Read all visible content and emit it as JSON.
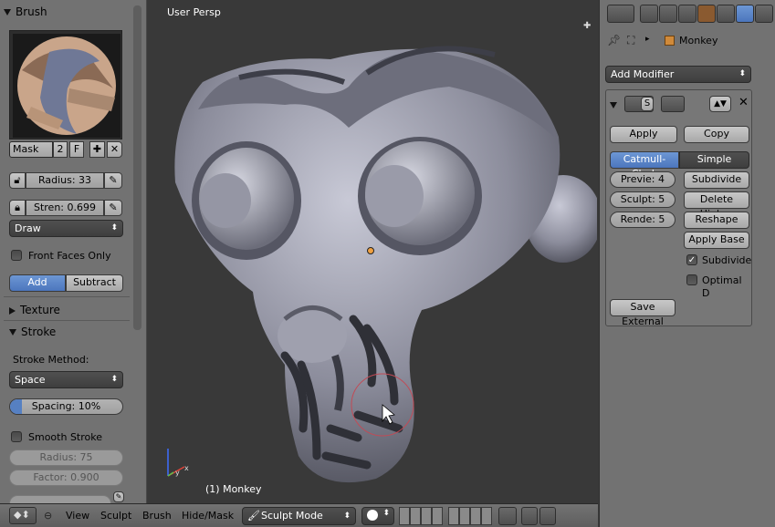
{
  "tool_panel": {
    "brush_header": "Brush",
    "brush_name": "Mask",
    "brush_users": "2",
    "fake_user": "F",
    "radius": "Radius: 33",
    "strength": "Stren: 0.699",
    "brush_type": "Draw",
    "front_faces_only": "Front Faces Only",
    "add_label": "Add",
    "subtract_label": "Subtract",
    "texture_header": "Texture",
    "stroke_header": "Stroke",
    "stroke_method_label": "Stroke Method:",
    "stroke_method": "Space",
    "spacing": "Spacing: 10%",
    "smooth_stroke": "Smooth Stroke",
    "smooth_radius": "Radius: 75",
    "smooth_factor": "Factor: 0.900"
  },
  "viewport": {
    "view_label": "User Persp",
    "object_label": "(1) Monkey"
  },
  "bottom_bar": {
    "menus": [
      "View",
      "Sculpt",
      "Brush",
      "Hide/Mask"
    ],
    "mode": "Sculpt Mode"
  },
  "properties": {
    "object_name": "Monkey",
    "add_modifier": "Add Modifier",
    "modifier_name": "S",
    "apply": "Apply",
    "copy": "Copy",
    "catmull_clark": "Catmull-Clark",
    "simple": "Simple",
    "preview": "Previe: 4",
    "sculpt": "Sculpt: 5",
    "render": "Rende: 5",
    "subdivide": "Subdivide",
    "delete_higher": "Delete Higher",
    "reshape": "Reshape",
    "apply_base": "Apply Base",
    "subdivide_uvs": "Subdivide",
    "optimal_display": "Optimal D",
    "save_external": "Save External"
  },
  "colors": {
    "accent_blue": "#5680c2",
    "panel_grey": "#727272",
    "viewport_bg": "#393939"
  }
}
